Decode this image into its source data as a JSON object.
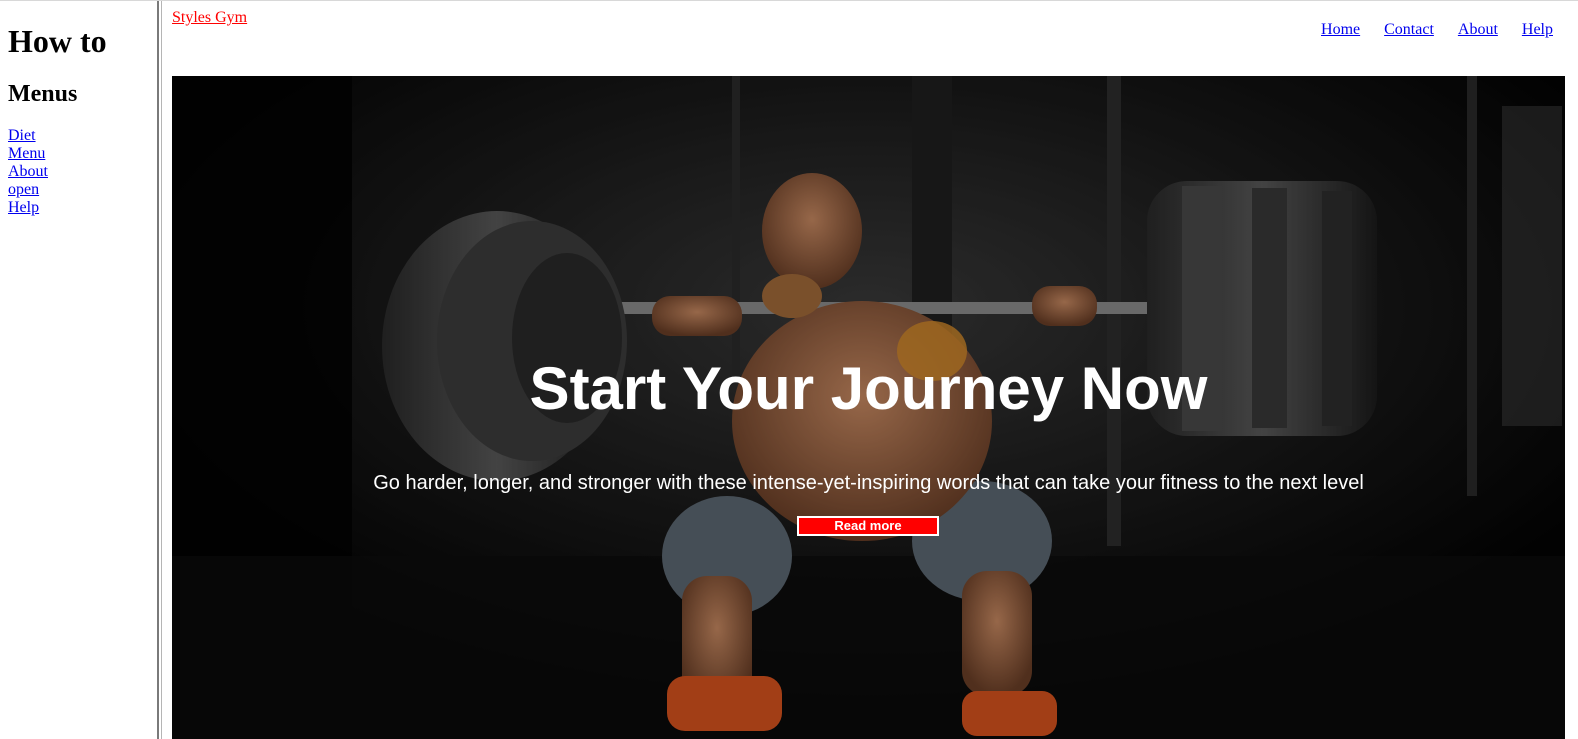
{
  "sidebar": {
    "title": "How to",
    "subtitle": "Menus",
    "links": [
      "Diet",
      "Menu",
      "About",
      "open",
      "Help"
    ]
  },
  "header": {
    "brand": "Styles Gym",
    "nav": [
      "Home",
      "Contact",
      "About",
      "Help"
    ]
  },
  "hero": {
    "title": "Start Your Journey Now",
    "subtitle": "Go harder, longer, and stronger with these intense-yet-inspiring words that can take your fitness to the next level",
    "button_label": "Read more",
    "image_subject": "athlete squatting with a loaded barbell in a dark gym"
  },
  "colors": {
    "brand_link": "#ff0000",
    "button_bg": "#ff0000",
    "link": "#0000ee",
    "hero_bg": "#050505"
  }
}
